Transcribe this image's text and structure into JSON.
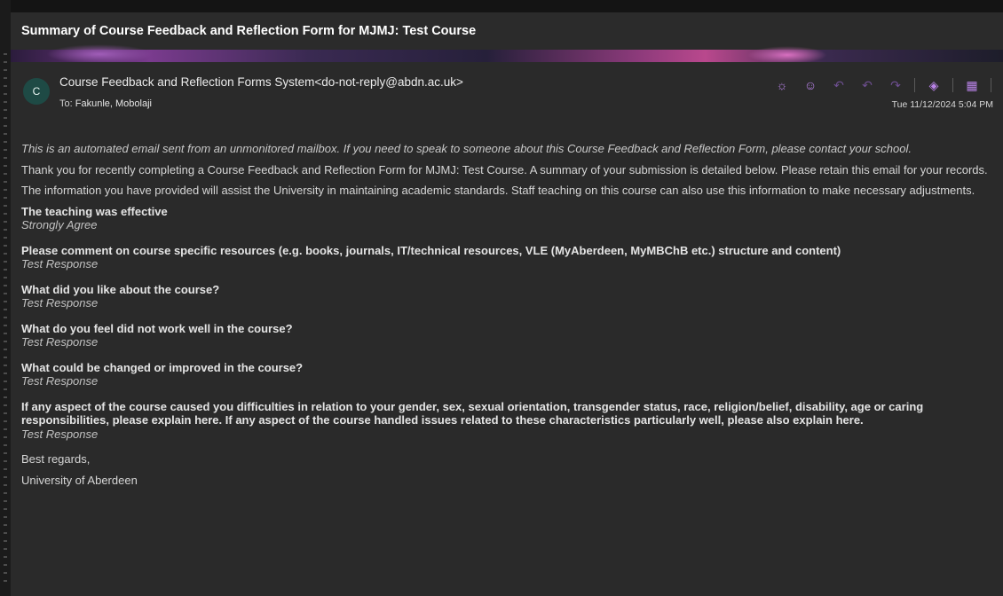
{
  "subject": "Summary of Course Feedback and Reflection Form for MJMJ: Test Course",
  "email": {
    "avatar_initial": "C",
    "sender": "Course Feedback and Reflection Forms System<do-not-reply@abdn.ac.uk>",
    "to_label": "To:",
    "to_name": "Fakunle, Mobolaji",
    "date": "Tue 11/12/2024 5:04 PM",
    "actions": [
      {
        "icon": "brightness-icon",
        "glyph": "☼"
      },
      {
        "icon": "emoji-icon",
        "glyph": "☺"
      },
      {
        "icon": "reply-icon",
        "glyph": "↶"
      },
      {
        "icon": "reply-all-icon",
        "glyph": "↶"
      },
      {
        "icon": "forward-icon",
        "glyph": "↷"
      },
      {
        "icon": "apps-icon",
        "glyph": "◈"
      },
      {
        "icon": "calendar-icon",
        "glyph": "▦"
      },
      {
        "icon": "more-icon",
        "glyph": "···"
      }
    ]
  },
  "body": {
    "intro": "This is an automated email sent from an unmonitored mailbox. If you need to speak to someone about this Course Feedback and Reflection Form, please contact your school.",
    "p1": "Thank you for recently completing a Course Feedback and Reflection Form for MJMJ: Test Course. A summary of your submission is detailed below. Please retain this email for your records.",
    "p2": "The information you have provided will assist the University in maintaining academic standards. Staff teaching on this course can also use this information to make necessary adjustments.",
    "qa": [
      {
        "q": "The teaching was effective",
        "a": "Strongly Agree"
      },
      {
        "q": "Please comment on course specific resources (e.g. books, journals, IT/technical resources, VLE (MyAberdeen, MyMBChB etc.) structure and content)",
        "a": "Test Response"
      },
      {
        "q": "What did you like about the course?",
        "a": "Test Response"
      },
      {
        "q": "What do you feel did not work well in the course?",
        "a": "Test Response"
      },
      {
        "q": "What could be changed or improved in the course?",
        "a": "Test Response"
      },
      {
        "q": "If any aspect of the course caused you difficulties in relation to your gender, sex, sexual orientation, transgender status, race, religion/belief, disability, age or caring responsibilities, please explain here. If any aspect of the course handled issues related to these characteristics particularly well, please also explain here.",
        "a": "Test Response"
      }
    ],
    "closing": "Best regards,",
    "signature": "University of Aberdeen"
  }
}
